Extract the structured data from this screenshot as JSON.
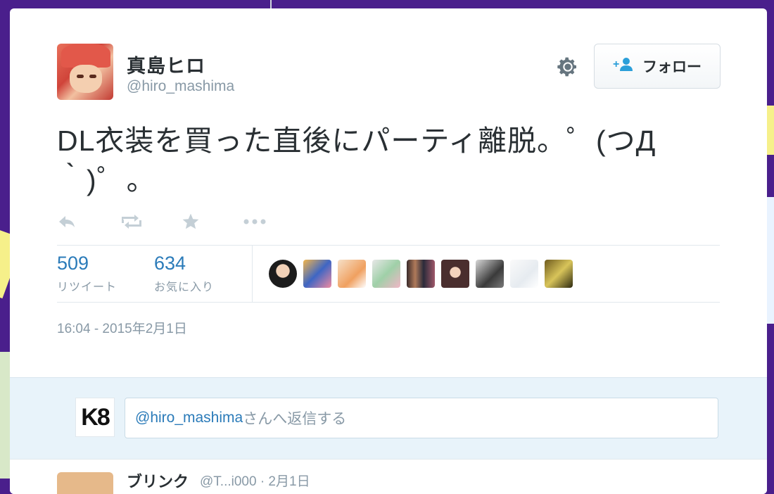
{
  "user": {
    "name": "真島ヒロ",
    "handle": "@hiro_mashima"
  },
  "follow_label": "フォロー",
  "tweet": {
    "text": "DL衣装を買った直後にパーティ離脱。゜(つД｀)゜。"
  },
  "stats": {
    "retweets": "509",
    "retweets_label": "リツイート",
    "favorites": "634",
    "favorites_label": "お気に入り"
  },
  "timestamp": "16:04 - 2015年2月1日",
  "reply": {
    "mention": "@hiro_mashima",
    "placeholder_suffix": "さんへ返信する",
    "avatar_text": "K8"
  },
  "next_tweet": {
    "name": "ブリンク",
    "meta": "@T...i000 · 2月1日"
  },
  "colors": {
    "background": "#4a1f8c",
    "link_blue": "#2b7bb9",
    "muted_gray": "#8899a6",
    "reply_bg": "#e8f3fa"
  },
  "icons": [
    "gear-icon",
    "add-user-icon",
    "reply-icon",
    "retweet-icon",
    "favorite-star-icon",
    "more-icon"
  ]
}
